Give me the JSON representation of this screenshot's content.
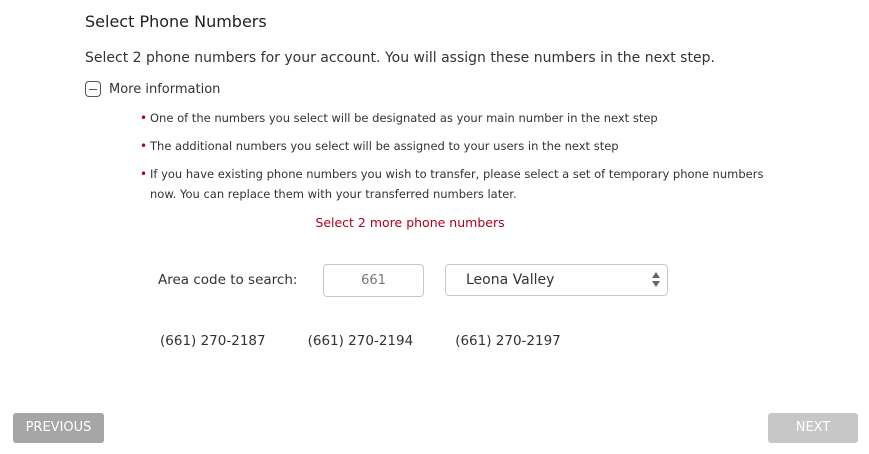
{
  "header": {
    "title": "Select Phone Numbers",
    "intro": "Select 2 phone numbers for your account. You will assign these numbers in the next step."
  },
  "more_info": {
    "label": "More information",
    "icon": "minus-square-icon",
    "bullets": [
      "One of the numbers you select will be designated as your main number in the next step",
      "The additional numbers you select will be assigned to your users in the next step",
      "If you have existing phone numbers you wish to transfer, please select a set of temporary phone numbers now. You can replace them with your transferred numbers later."
    ]
  },
  "status": {
    "select_more": "Select 2 more phone numbers"
  },
  "search": {
    "area_label": "Area code to search:",
    "area_code": "661",
    "city": "Leona Valley"
  },
  "numbers": [
    "(661) 270-2187",
    "(661) 270-2194",
    "(661) 270-2197"
  ],
  "nav": {
    "previous": "PREVIOUS",
    "next": "NEXT"
  },
  "colors": {
    "accent_red": "#b0001e",
    "button_prev": "#a6a6a6",
    "button_next_disabled": "#c7c7c7"
  }
}
